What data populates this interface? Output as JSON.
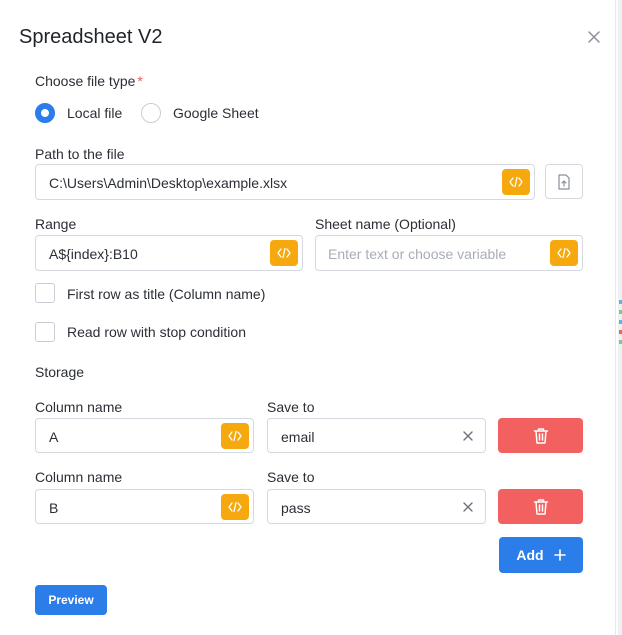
{
  "dialog": {
    "title": "Spreadsheet V2"
  },
  "file_type": {
    "label": "Choose file type",
    "required_mark": "*",
    "options": [
      "Local file",
      "Google Sheet"
    ],
    "selected": "Local file"
  },
  "path": {
    "label": "Path to the file",
    "value": "C:\\Users\\Admin\\Desktop\\example.xlsx"
  },
  "range": {
    "label": "Range",
    "value": "A${index}:B10"
  },
  "sheet": {
    "label": "Sheet name (Optional)",
    "placeholder": "Enter text or choose variable"
  },
  "options": {
    "first_row_title": {
      "label": "First row as title (Column name)",
      "checked": false
    },
    "stop_condition": {
      "label": "Read row with stop condition",
      "checked": false
    }
  },
  "storage": {
    "label": "Storage",
    "rows": [
      {
        "column_label": "Column name",
        "column_value": "A",
        "save_label": "Save to",
        "save_value": "email"
      },
      {
        "column_label": "Column name",
        "column_value": "B",
        "save_label": "Save to",
        "save_value": "pass"
      }
    ],
    "add_label": "Add"
  },
  "preview_label": "Preview",
  "colors": {
    "primary": "#2b7de9",
    "variable_button": "#f6a90f",
    "delete_button": "#f26060",
    "required": "#f05454"
  },
  "icons": {
    "variable": "code-brackets-icon",
    "upload": "file-upload-icon",
    "delete": "trash-icon",
    "add": "plus-icon",
    "close": "close-icon",
    "clear": "clear-x-icon"
  }
}
